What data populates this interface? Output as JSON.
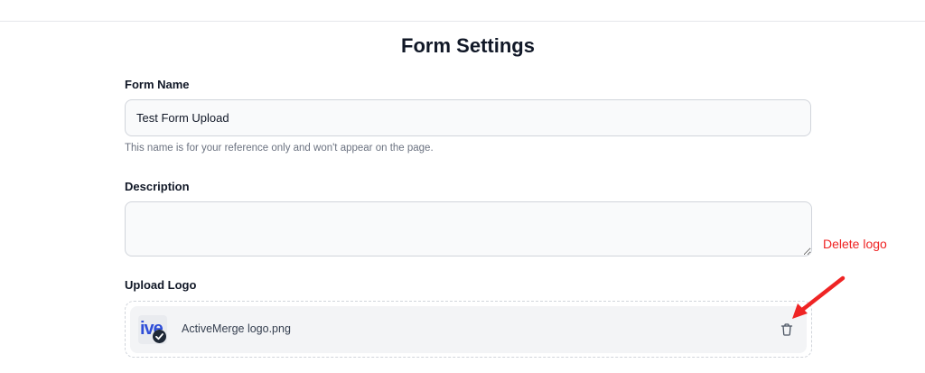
{
  "page": {
    "title": "Form Settings"
  },
  "form_name": {
    "label": "Form Name",
    "value": "Test Form Upload",
    "helper": "This name is for your reference only and won't appear on the page."
  },
  "description": {
    "label": "Description",
    "value": ""
  },
  "upload_logo": {
    "label": "Upload Logo",
    "file": {
      "name": "ActiveMerge logo.png",
      "thumb_text": "ive",
      "thumb_icon": "check-badge-icon",
      "action_icon": "trash-icon"
    }
  },
  "annotation": {
    "label": "Delete logo",
    "color": "#ef2424",
    "icon": "arrow-icon"
  },
  "colors": {
    "accent_brand": "#2f4ed8",
    "input_bg": "#f9fafb",
    "border": "#d1d5db"
  }
}
